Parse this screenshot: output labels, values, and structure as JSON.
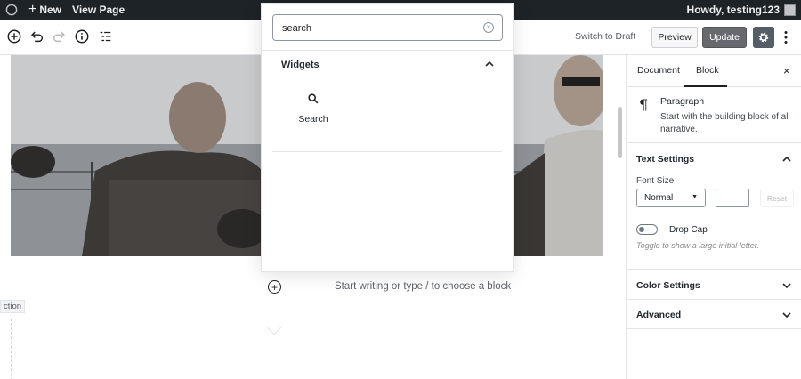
{
  "admin_bar": {
    "new_label": "New",
    "view_page_label": "View Page",
    "greeting": "Howdy, testing123"
  },
  "editor_toolbar": {
    "switch_to_draft": "Switch to Draft",
    "preview": "Preview",
    "update": "Update"
  },
  "inserter": {
    "search_value": "search",
    "panel_title": "Widgets",
    "results": [
      {
        "label": "Search",
        "icon": "search-icon"
      }
    ]
  },
  "content": {
    "placeholder": "Start writing or type / to choose a block",
    "section_tag": "ction"
  },
  "sidebar": {
    "tabs": [
      "Document",
      "Block"
    ],
    "active_tab": "Block",
    "block_card": {
      "title": "Paragraph",
      "description": "Start with the building block of all narrative."
    },
    "text_settings": {
      "title": "Text Settings",
      "font_size_label": "Font Size",
      "font_size_value": "Normal",
      "reset_label": "Reset",
      "drop_cap_label": "Drop Cap",
      "drop_cap_help": "Toggle to show a large initial letter."
    },
    "color_settings_title": "Color Settings",
    "advanced_title": "Advanced"
  },
  "colors": {
    "admin_bar_bg": "#1d2327",
    "update_button_bg": "#666a6f",
    "settings_button_bg": "#555d66"
  }
}
